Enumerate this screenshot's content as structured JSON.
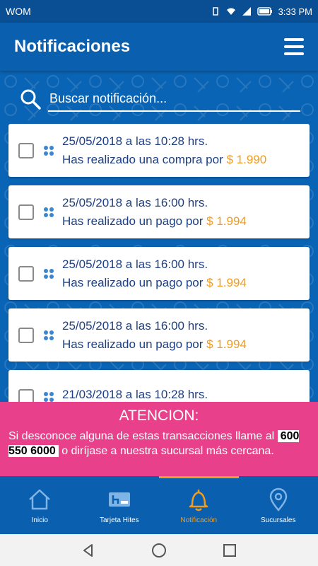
{
  "status_bar": {
    "carrier": "WOM",
    "time": "3:33 PM"
  },
  "app_bar": {
    "title": "Notificaciones"
  },
  "search": {
    "placeholder": "Buscar notificación..."
  },
  "notifications": [
    {
      "date": "25/05/2018 a las 10:28 hrs.",
      "message": "Has realizado una compra por",
      "amount": "$ 1.990"
    },
    {
      "date": "25/05/2018 a las 16:00 hrs.",
      "message": "Has realizado un pago por",
      "amount": "$ 1.994"
    },
    {
      "date": "25/05/2018 a las 16:00 hrs.",
      "message": "Has realizado un pago por",
      "amount": "$ 1.994"
    },
    {
      "date": "25/05/2018 a las 16:00 hrs.",
      "message": "Has realizado un pago por",
      "amount": "$ 1.994"
    },
    {
      "date": "21/03/2018 a las 10:28 hrs.",
      "message": "",
      "amount": ""
    }
  ],
  "alert": {
    "title": "ATENCION:",
    "body_start": "Si desconoce alguna de estas transacciones llame al",
    "phone": "600 550 6000",
    "body_end": "o diríjase a nuestra sucursal más cercana."
  },
  "bottom_nav": [
    {
      "label": "Inicio",
      "icon": "home-icon"
    },
    {
      "label": "Tarjeta Hites",
      "icon": "card-icon"
    },
    {
      "label": "Notificación",
      "icon": "bell-icon"
    },
    {
      "label": "Sucursales",
      "icon": "location-pin-icon"
    }
  ],
  "colors": {
    "primary": "#0a5fae",
    "accent": "#f29c1f",
    "alert": "#e8408a",
    "text_dark": "#1c3f84"
  }
}
